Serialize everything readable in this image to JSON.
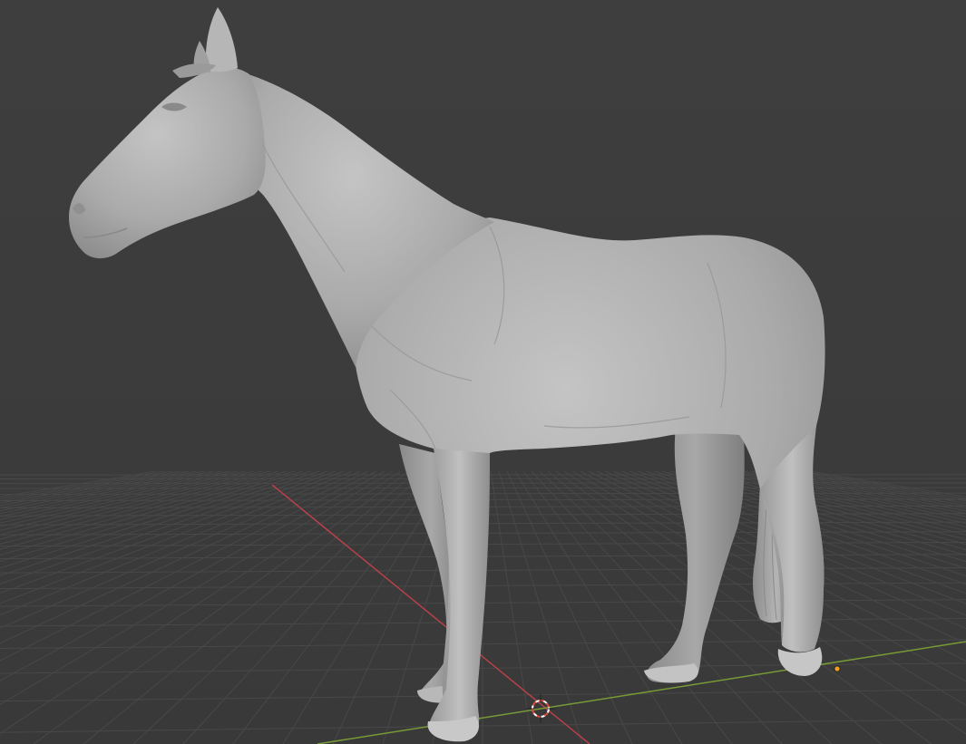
{
  "viewport": {
    "background_color": "#3d3d3d",
    "grid_color": "#4a4a4a",
    "x_axis_color": "#c0414b",
    "y_axis_color": "#7a9f36"
  },
  "model": {
    "object": "horse-sculpt-mesh",
    "shading": "solid",
    "color": "#a9a9a9"
  },
  "cursor_3d": {
    "icon": "3d-cursor-icon",
    "ring_color": "#e04a3c"
  },
  "origin_point": {
    "icon": "object-origin-dot",
    "color": "#f2a01a"
  }
}
